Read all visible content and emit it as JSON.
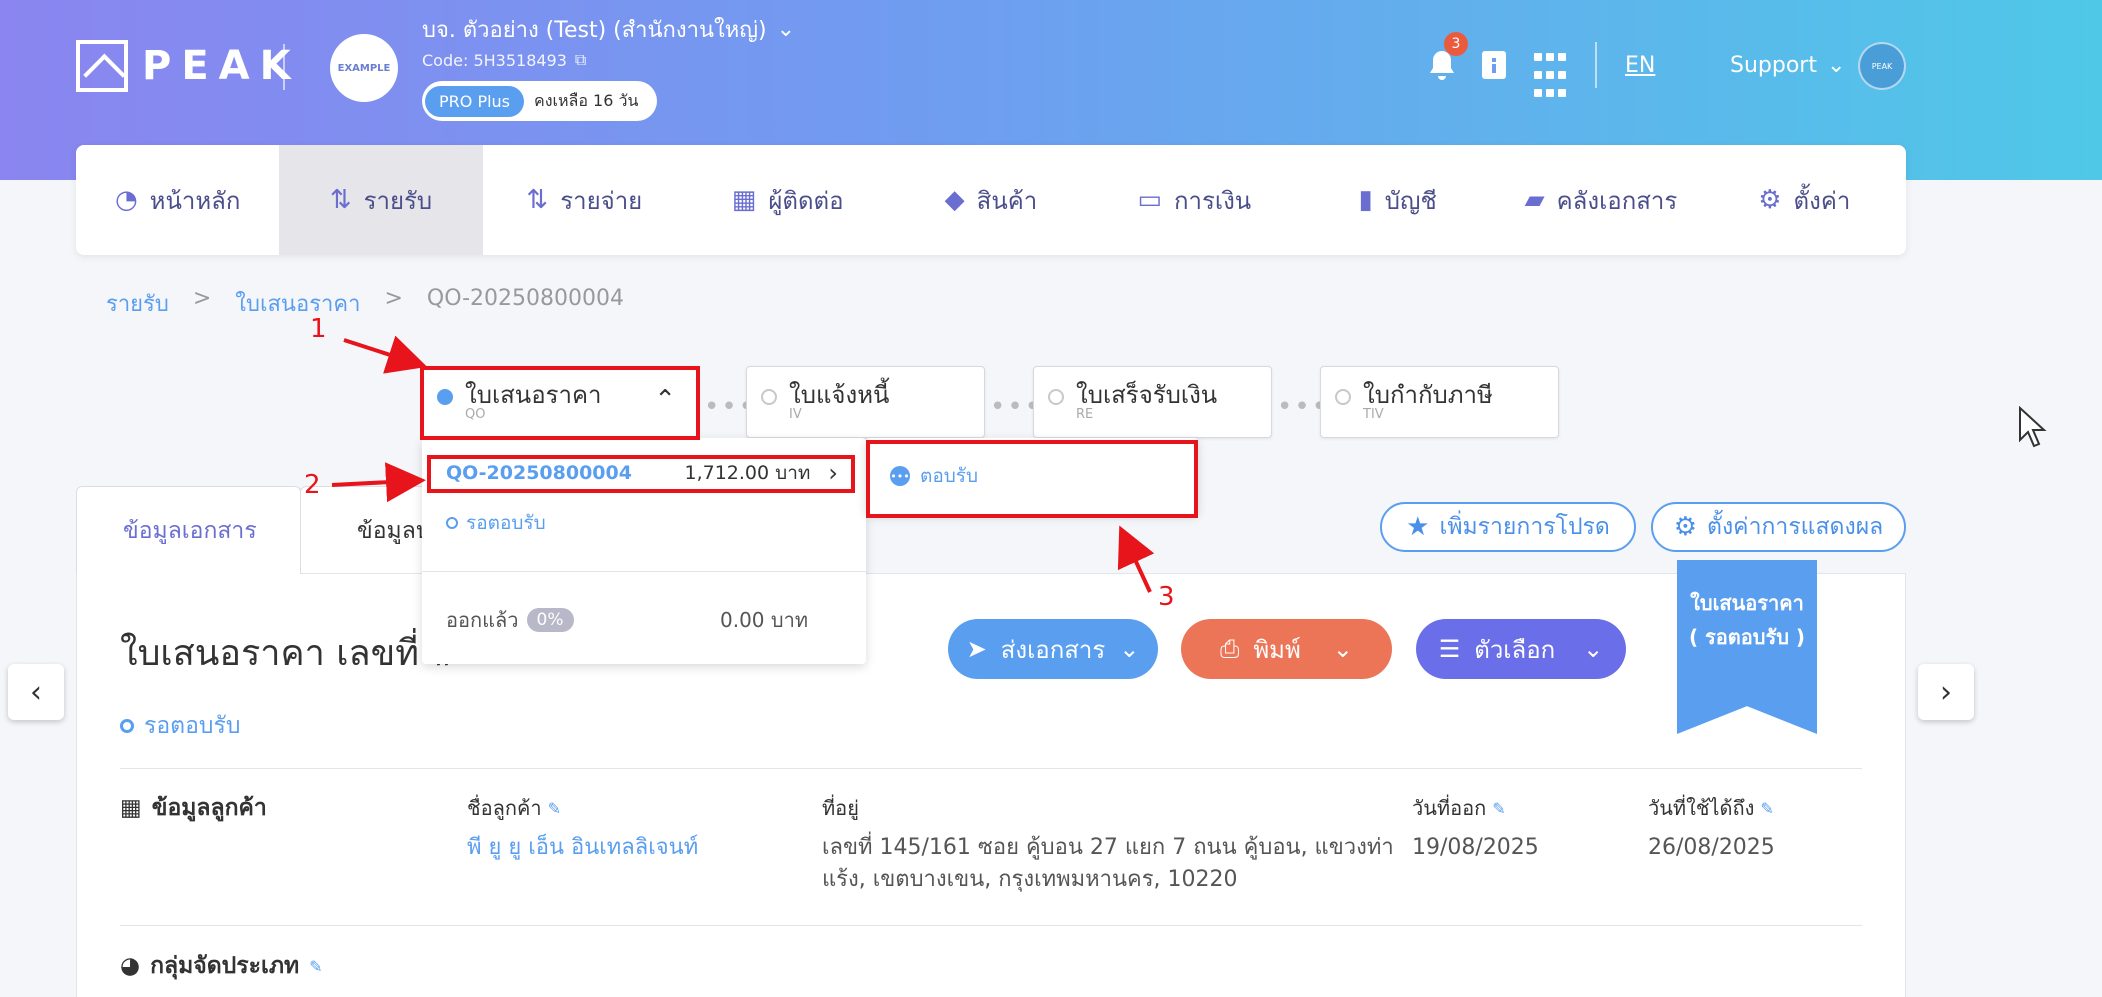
{
  "header": {
    "logo_text": "PEAK",
    "company_avatar_text": "EXAMPLE",
    "company_name": "บจ. ตัวอย่าง (Test) (สำนักงานใหญ่)",
    "company_code": "Code: 5H3518493",
    "plan": "PRO Plus",
    "plan_remaining": "คงเหลือ 16 วัน",
    "notification_count": "3",
    "language": "EN",
    "support": "Support",
    "user_avatar_text": "PEAK"
  },
  "nav": {
    "items": [
      {
        "label": "หน้าหลัก",
        "icon": "dashboard-icon"
      },
      {
        "label": "รายรับ",
        "icon": "income-icon"
      },
      {
        "label": "รายจ่าย",
        "icon": "expense-icon"
      },
      {
        "label": "ผู้ติดต่อ",
        "icon": "contacts-icon"
      },
      {
        "label": "สินค้า",
        "icon": "product-box-icon"
      },
      {
        "label": "การเงิน",
        "icon": "money-icon"
      },
      {
        "label": "บัญชี",
        "icon": "ledger-icon"
      },
      {
        "label": "คลังเอกสาร",
        "icon": "folder-icon"
      },
      {
        "label": "ตั้งค่า",
        "icon": "gear-icon"
      }
    ],
    "active_index": 1
  },
  "breadcrumb": {
    "level1": "รายรับ",
    "level2": "ใบเสนอราคา",
    "level3": "QO-20250800004",
    "sep": ">"
  },
  "steps": [
    {
      "label": "ใบเสนอราคา",
      "sub": "QO"
    },
    {
      "label": "ใบแจ้งหนี้",
      "sub": "IV"
    },
    {
      "label": "ใบเสร็จรับเงิน",
      "sub": "RE"
    },
    {
      "label": "ใบกำกับภาษี",
      "sub": "TIV"
    }
  ],
  "dropdown": {
    "doc_code": "QO-20250800004",
    "doc_amount": "1,712.00 บาท",
    "status": "รอตอบรับ",
    "issued_label": "ออกแล้ว",
    "issued_pct": "0%",
    "issued_amount": "0.00 บาท",
    "side_action": "ตอบรับ"
  },
  "tabs": {
    "doc_info": "ข้อมูลเอกสาร",
    "other_partial": "ข้อมูลป"
  },
  "buttons": {
    "add_favorite": "เพิ่มรายการโปรด",
    "display_settings": "ตั้งค่าการแสดงผล",
    "send": "ส่งเอกสาร",
    "print": "พิมพ์",
    "options": "ตัวเลือก"
  },
  "document": {
    "title": "ใบเสนอราคา เลขที่ #",
    "status": "รอตอบรับ",
    "ribbon_line1": "ใบเสนอราคา",
    "ribbon_line2": "( รอตอบรับ )"
  },
  "customer": {
    "section_title": "ข้อมูลลูกค้า",
    "name_label": "ชื่อลูกค้า",
    "name": "พี ยู ยู เอ็น อินเทลลิเจนท์",
    "address_label": "ที่อยู่",
    "address_line1": "เลขที่ 145/161 ซอย คู้บอน 27 แยก 7 ถนน คู้บอน, แขวงท่า",
    "address_line2": "แร้ง, เขตบางเขน, กรุงเทพมหานคร, 10220",
    "issue_date_label": "วันที่ออก",
    "issue_date": "19/08/2025",
    "valid_until_label": "วันที่ใช้ได้ถึง",
    "valid_until": "26/08/2025"
  },
  "category": {
    "section_title": "กลุ่มจัดประเภท"
  },
  "annotations": {
    "n1": "1",
    "n2": "2",
    "n3": "3"
  },
  "colors": {
    "accent": "#5a9ef0",
    "print": "#ec7558",
    "options": "#6a6ee8",
    "annotation": "#e8141c"
  }
}
